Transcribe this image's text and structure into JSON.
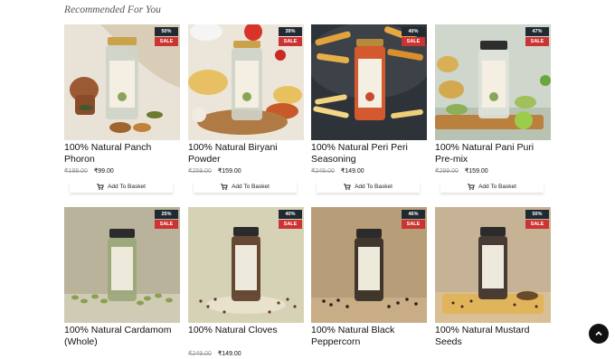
{
  "section": {
    "title": "Recommended For You"
  },
  "products": [
    {
      "name": "100% Natural Panch Phoron",
      "old_price": "₹199.00",
      "price": "₹99.00",
      "discount": "50%",
      "sale": "SALE",
      "basket_label": "Add To Basket",
      "jar_label": "Panch Phoron"
    },
    {
      "name": "100% Natural Biryani Powder",
      "old_price": "₹259.00",
      "price": "₹159.00",
      "discount": "39%",
      "sale": "SALE",
      "basket_label": "Add To Basket",
      "jar_label": "Biryani Powder"
    },
    {
      "name": "100% Natural Peri Peri Seasoning",
      "old_price": "₹249.00",
      "price": "₹149.00",
      "discount": "40%",
      "sale": "SALE",
      "basket_label": "Add To Basket",
      "jar_label": "Peri Peri Seasoning"
    },
    {
      "name": "100% Natural Pani Puri Pre-mix",
      "old_price": "₹299.00",
      "price": "₹159.00",
      "discount": "47%",
      "sale": "SALE",
      "basket_label": "Add To Basket",
      "jar_label": "Pani Puri Pre-mix"
    },
    {
      "name": "100% Natural Cardamom (Whole)",
      "old_price": "",
      "price": "",
      "discount": "25%",
      "sale": "SALE",
      "basket_label": "",
      "jar_label": "Cardamom Whole"
    },
    {
      "name": "100% Natural Cloves",
      "old_price": "₹249.00",
      "price": "₹149.00",
      "discount": "40%",
      "sale": "SALE",
      "basket_label": "",
      "jar_label": "Cloves Whole"
    },
    {
      "name": "100% Natural Black Peppercorn",
      "old_price": "",
      "price": "",
      "discount": "46%",
      "sale": "SALE",
      "basket_label": "",
      "jar_label": "Black Peppercorn"
    },
    {
      "name": "100% Natural Mustard Seeds",
      "old_price": "",
      "price": "",
      "discount": "50%",
      "sale": "SALE",
      "basket_label": "",
      "jar_label": "Mustard Seeds"
    }
  ],
  "icons": {
    "basket": "shopping-cart-icon",
    "scroll_top": "chevron-up-icon"
  }
}
